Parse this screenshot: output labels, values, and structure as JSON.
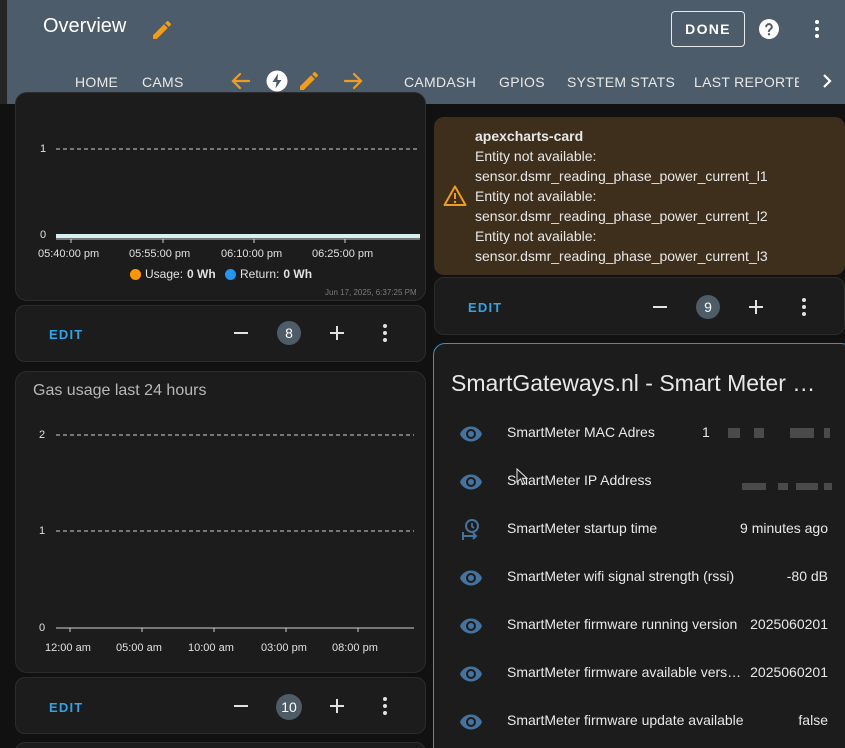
{
  "header": {
    "title": "Overview",
    "done_label": "DONE",
    "tabs": [
      "HOME",
      "CAMS",
      "CAMDASH",
      "GPIOS",
      "SYSTEM STATS",
      "LAST REPORTED"
    ],
    "colors": {
      "bar": "#4d5c6a",
      "accent": "#f09c1f"
    }
  },
  "card_power": {
    "chart_data": {
      "type": "line",
      "x": [
        "05:40:00 pm",
        "05:55:00 pm",
        "06:10:00 pm",
        "06:25:00 pm"
      ],
      "yticks": [
        "1",
        "0"
      ],
      "ylim": [
        0,
        1
      ],
      "series": [
        {
          "name": "Usage:",
          "value_label": "0 Wh",
          "color": "#ff9800",
          "values": [
            0,
            0,
            0,
            0
          ]
        },
        {
          "name": "Return:",
          "value_label": "0 Wh",
          "color": "#2196f3",
          "values": [
            0,
            0,
            0,
            0
          ]
        }
      ],
      "grid": true,
      "legend": "bottom"
    },
    "timestamp": "Jun 17, 2025, 6:37:25 PM",
    "footer": {
      "edit": "EDIT",
      "count": "8"
    }
  },
  "card_gas": {
    "title": "Gas usage last 24 hours",
    "chart_data": {
      "type": "line",
      "x": [
        "12:00 am",
        "05:00 am",
        "10:00 am",
        "03:00 pm",
        "08:00 pm"
      ],
      "yticks": [
        "2",
        "1",
        "0"
      ],
      "ylim": [
        0,
        2
      ],
      "series": [],
      "grid": true
    },
    "footer": {
      "edit": "EDIT",
      "count": "10"
    }
  },
  "warning_card": {
    "heading": "apexcharts-card",
    "lines": [
      "Entity not available:",
      "sensor.dsmr_reading_phase_power_current_l1",
      "Entity not available:",
      "sensor.dsmr_reading_phase_power_current_l2",
      "Entity not available:",
      "sensor.dsmr_reading_phase_power_current_l3"
    ],
    "footer": {
      "edit": "EDIT",
      "count": "9"
    }
  },
  "entities_card": {
    "title": "SmartGateways.nl - Smart Meter Gateway",
    "rows": [
      {
        "icon": "eye-icon",
        "name": "SmartMeter MAC Adres",
        "value": "1"
      },
      {
        "icon": "eye-icon",
        "name": "SmartMeter IP Address",
        "value": ""
      },
      {
        "icon": "clock-start-icon",
        "name": "SmartMeter startup time",
        "value": "9 minutes ago"
      },
      {
        "icon": "eye-icon",
        "name": "SmartMeter wifi signal strength (rssi)",
        "value": "-80 dB"
      },
      {
        "icon": "eye-icon",
        "name": "SmartMeter firmware running version",
        "value": "2025060201"
      },
      {
        "icon": "eye-icon",
        "name": "SmartMeter firmware available version",
        "value": "2025060201"
      },
      {
        "icon": "eye-icon",
        "name": "SmartMeter firmware update available",
        "value": "false"
      }
    ]
  }
}
